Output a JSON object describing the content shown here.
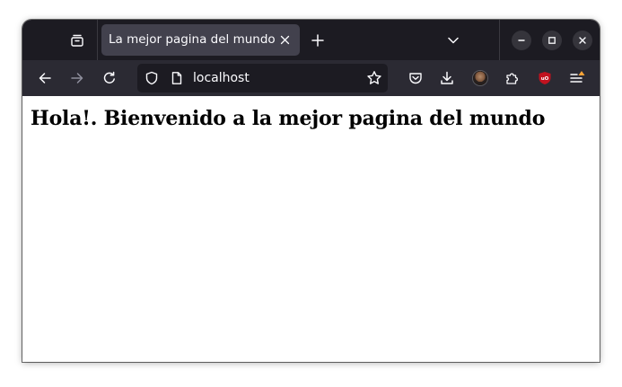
{
  "tab": {
    "title": "La mejor pagina del mundo"
  },
  "toolbar": {
    "url": "localhost"
  },
  "page": {
    "heading": "Hola!. Bienvenido a la mejor pagina del mundo"
  },
  "icons": {
    "tab_overview": "tab-overview-icon",
    "tab_close": "close-icon",
    "new_tab": "plus-icon",
    "tab_list": "chevron-down-icon",
    "minimize": "minimize-icon",
    "maximize": "maximize-icon",
    "close_window": "close-icon",
    "back": "arrow-left-icon",
    "forward": "arrow-right-icon",
    "reload": "reload-icon",
    "shield": "shield-icon",
    "page": "page-icon",
    "bookmark": "star-icon",
    "pocket": "pocket-icon",
    "downloads": "download-icon",
    "account": "avatar",
    "extensions": "puzzle-icon",
    "ublock": "ublock-icon",
    "menu": "hamburger-menu-icon"
  },
  "colors": {
    "titlebar": "#1c1b22",
    "active_tab": "#42414d",
    "navbar": "#2b2a33",
    "urlbar": "#1c1b22",
    "icon": "#fbfbfe",
    "ublock_red": "#c1121f",
    "menu_badge": "#ffa436"
  }
}
